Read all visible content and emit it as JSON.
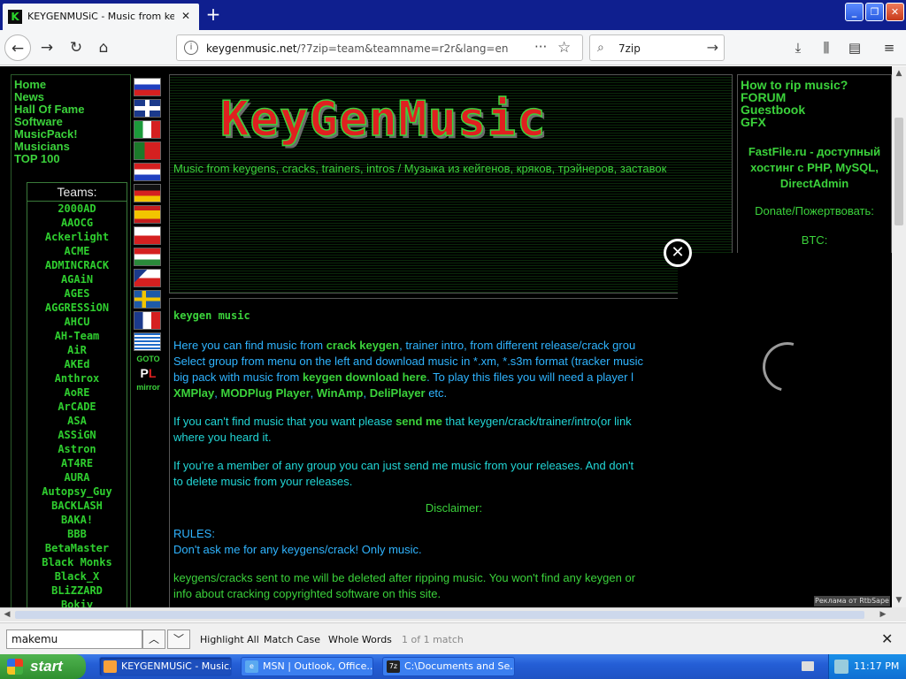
{
  "browser": {
    "tab_title": "KEYGENMUSiC - Music from keyge",
    "tab_close": "✕",
    "new_tab": "+",
    "window_buttons": [
      "_",
      "❐",
      "✕"
    ],
    "url_host": "keygenmusic.net",
    "url_path": "/?7zip=team&teamname=r2r&lang=en",
    "search_value": "7zip"
  },
  "left_nav": {
    "links": [
      "Home",
      "News",
      "Hall Of Fame",
      "Software",
      "MusicPack!",
      "Musicians",
      "TOP 100"
    ],
    "teams_title": "Teams:",
    "teams": [
      "2000AD",
      "AAOCG",
      "Ackerlight",
      "ACME",
      "ADMINCRACK",
      "AGAiN",
      "AGES",
      "AGGRESSiON",
      "AHCU",
      "AH-Team",
      "AiR",
      "AKEd",
      "Anthrox",
      "AoRE",
      "ArCADE",
      "ASA",
      "ASSiGN",
      "Astron",
      "AT4RE",
      "AURA",
      "Autopsy_Guy",
      "BACKLASH",
      "BAKA!",
      "BBB",
      "BetaMaster",
      "Black Monks",
      "Black_X",
      "BLiZZARD",
      "Bokiy"
    ]
  },
  "flags": {
    "goto": "GOTO",
    "pl_p": "P",
    "pl_l": "L",
    "mirror": "mirror"
  },
  "header": {
    "logo": "KeyGenMusic",
    "subtitle": "Music from keygens, cracks, trainers, intros / Музыка из кейгенов, кряков, трэйнеров, заставок"
  },
  "content": {
    "title": "keygen music",
    "p1_a": "Here you can find music from ",
    "p1_b": "crack keygen",
    "p1_c": ", trainer intro, from different release/crack grou",
    "p1_d": "Select group from menu on the left and download music in *.xm, *.s3m format (tracker music",
    "p1_e": "big pack with music from ",
    "p1_f": "keygen download here",
    "p1_g": ". To play this files you will need a player l",
    "p1_h": "XMPlay",
    "p1_i": ", ",
    "p1_j": "MODPlug Player",
    "p1_k": ", ",
    "p1_l": "WinAmp",
    "p1_m": ", ",
    "p1_n": "DeliPlayer",
    "p1_o": " etc.",
    "p2_a": "If you can't find music that you want please ",
    "p2_b": "send me",
    "p2_c": " that keygen/crack/trainer/intro(or link",
    "p2_d": "where you heard it.",
    "p3_a": "If you're a member of any group you can just send me music from your releases. And don't",
    "p3_b": "to delete music from your releases.",
    "disclaimer": "Disclaimer:",
    "rules_title": "RULES:",
    "rules_line": "Don't ask me for any keygens/crack! Only music.",
    "p5_a": "keygens/cracks sent to me will be deleted after ripping music. You won't find any keygen or",
    "p5_b": "info about cracking copyrighted software on this site."
  },
  "right_col": {
    "links": [
      "How to rip music?",
      "FORUM",
      "Guestbook",
      "GFX"
    ],
    "fastfile": "FastFile.ru - доступный хостинг с PHP, MySQL, DirectAdmin",
    "donate": "Donate/Пожертвовать:",
    "btc": "BTC:"
  },
  "ad": {
    "close": "✕",
    "label": "Реклама от RtbSape"
  },
  "findbar": {
    "value": "makemu",
    "highlight_all": "Highlight All",
    "match_case": "Match Case",
    "whole_words": "Whole Words",
    "count": "1 of 1 match",
    "close": "✕"
  },
  "taskbar": {
    "start": "start",
    "tasks": [
      "KEYGENMUSiC - Music...",
      "MSN | Outlook, Office...",
      "C:\\Documents and Se..."
    ],
    "clock": "11:17 PM"
  }
}
